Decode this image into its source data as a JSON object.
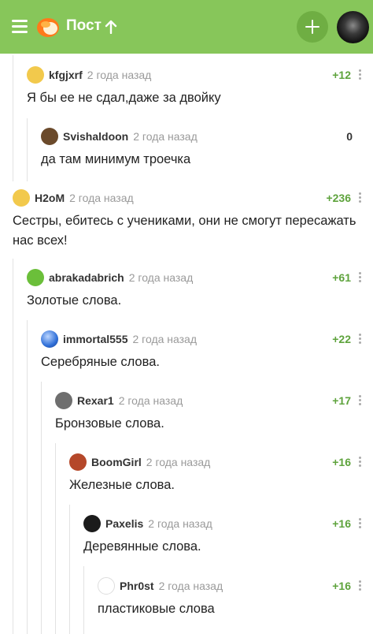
{
  "header": {
    "title": "Пост"
  },
  "comments": [
    {
      "user": "kfgjxrf",
      "time": "2 года назад",
      "rating": "+12",
      "text": "Я бы ее не сдал,даже за двойку",
      "avatar_color": "#f2c94c"
    },
    {
      "user": "Svishaldoon",
      "time": "2 года назад",
      "rating": "0",
      "text": "да там минимум троечка",
      "avatar_color": "#6b4a2b"
    },
    {
      "user": "H2oM",
      "time": "2 года назад",
      "rating": "+236",
      "text": "Сестры, ебитесь с учениками, они не смогут пересажать нас всех!",
      "avatar_color": "#f2c94c"
    },
    {
      "user": "abrakadabrich",
      "time": "2 года назад",
      "rating": "+61",
      "text": "Золотые слова.",
      "avatar_color": "#6bbf3a"
    },
    {
      "user": "immortal555",
      "time": "2 года назад",
      "rating": "+22",
      "text": "Серебряные слова.",
      "avatar_color": "#2f6fd8"
    },
    {
      "user": "Rexar1",
      "time": "2 года назад",
      "rating": "+17",
      "text": "Бронзовые слова.",
      "avatar_color": "#6e6e6e"
    },
    {
      "user": "BoomGirl",
      "time": "2 года назад",
      "rating": "+16",
      "text": "Железные слова.",
      "avatar_color": "#b5482a"
    },
    {
      "user": "Paxelis",
      "time": "2 года назад",
      "rating": "+16",
      "text": "Деревянные слова.",
      "avatar_color": "#1b1b1b"
    },
    {
      "user": "Phr0st",
      "time": "2 года назад",
      "rating": "+16",
      "text": "пластиковые слова",
      "avatar_color": "#ffffff"
    }
  ]
}
